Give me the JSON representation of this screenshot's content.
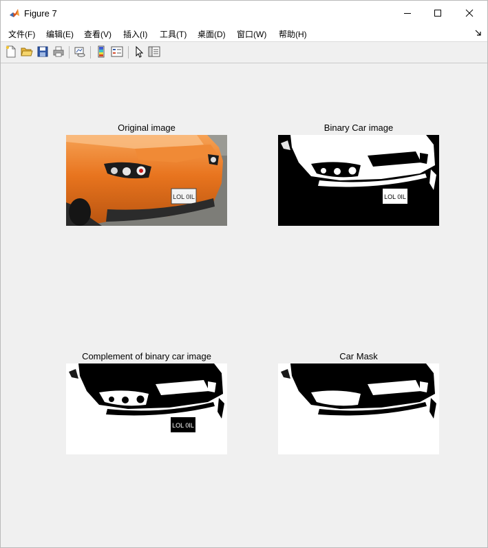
{
  "window": {
    "title": "Figure 7"
  },
  "menu": [
    {
      "key": "file",
      "label": "文件(F)"
    },
    {
      "key": "edit",
      "label": "编辑(E)"
    },
    {
      "key": "view",
      "label": "查看(V)"
    },
    {
      "key": "insert",
      "label": "插入(I)"
    },
    {
      "key": "tools",
      "label": "工具(T)"
    },
    {
      "key": "desktop",
      "label": "桌面(D)"
    },
    {
      "key": "window",
      "label": "窗口(W)"
    },
    {
      "key": "help",
      "label": "帮助(H)"
    }
  ],
  "toolbar_icons": [
    "new-figure-icon",
    "open-file-icon",
    "save-icon",
    "print-icon",
    "link-plot-icon",
    "insert-colorbar-icon",
    "insert-legend-icon",
    "edit-plot-arrow-icon",
    "property-inspector-icon"
  ],
  "subplots": [
    {
      "title": "Original image",
      "plate": "LOL 0IL"
    },
    {
      "title": "Binary Car image",
      "plate": "LOL 0IL"
    },
    {
      "title": "Complement of binary car image",
      "plate": "LOL 0IL"
    },
    {
      "title": "Car Mask"
    }
  ],
  "colors": {
    "car_orange": "#e8741e",
    "window_bg": "#f0f0f0"
  }
}
